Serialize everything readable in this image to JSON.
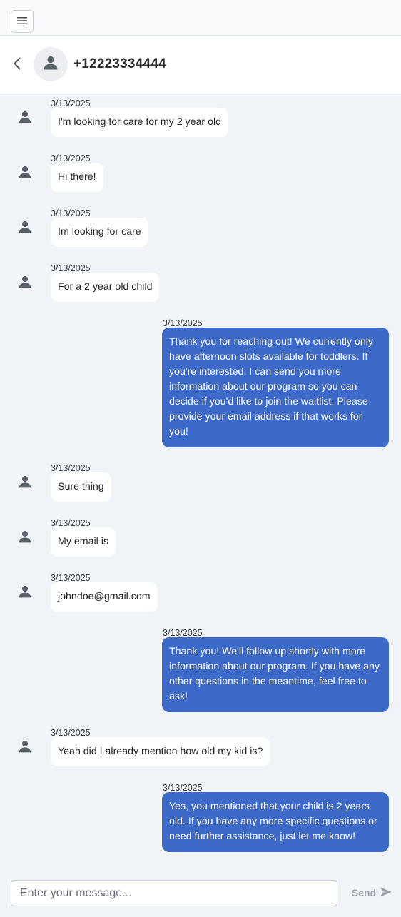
{
  "topbar": {
    "menu_icon": "hamburger-menu-icon"
  },
  "header": {
    "back_icon": "chevron-left-icon",
    "avatar_icon": "person-icon",
    "phone": "+12223334444"
  },
  "messages": [
    {
      "direction": "in",
      "date": "3/13/2025",
      "text": "I'm looking for care for my 2 year old"
    },
    {
      "direction": "in",
      "date": "3/13/2025",
      "text": "Hi there!"
    },
    {
      "direction": "in",
      "date": "3/13/2025",
      "text": "Im looking for care"
    },
    {
      "direction": "in",
      "date": "3/13/2025",
      "text": "For a 2 year old child"
    },
    {
      "direction": "out",
      "date": "3/13/2025",
      "text": "Thank you for reaching out! We currently only have afternoon slots available for toddlers. If you're interested, I can send you more information about our program so you can decide if you'd like to join the waitlist. Please provide your email address if that works for you!"
    },
    {
      "direction": "in",
      "date": "3/13/2025",
      "text": "Sure thing"
    },
    {
      "direction": "in",
      "date": "3/13/2025",
      "text": "My email is"
    },
    {
      "direction": "in",
      "date": "3/13/2025",
      "text": "johndoe@gmail.com"
    },
    {
      "direction": "out",
      "date": "3/13/2025",
      "text": "Thank you! We'll follow up shortly with more information about our program. If you have any other questions in the meantime, feel free to ask!"
    },
    {
      "direction": "in",
      "date": "3/13/2025",
      "text": "Yeah did I already mention how old my kid is?"
    },
    {
      "direction": "out",
      "date": "3/13/2025",
      "text": "Yes, you mentioned that your child is 2 years old. If you have any more specific questions or need further assistance, just let me know!"
    }
  ],
  "composer": {
    "placeholder": "Enter your message...",
    "value": "",
    "send_label": "Send",
    "send_icon": "send-arrow-icon"
  },
  "colors": {
    "outgoing_bubble": "#3d6ac8",
    "incoming_bubble": "#ffffff",
    "background": "#f0f3f7"
  }
}
